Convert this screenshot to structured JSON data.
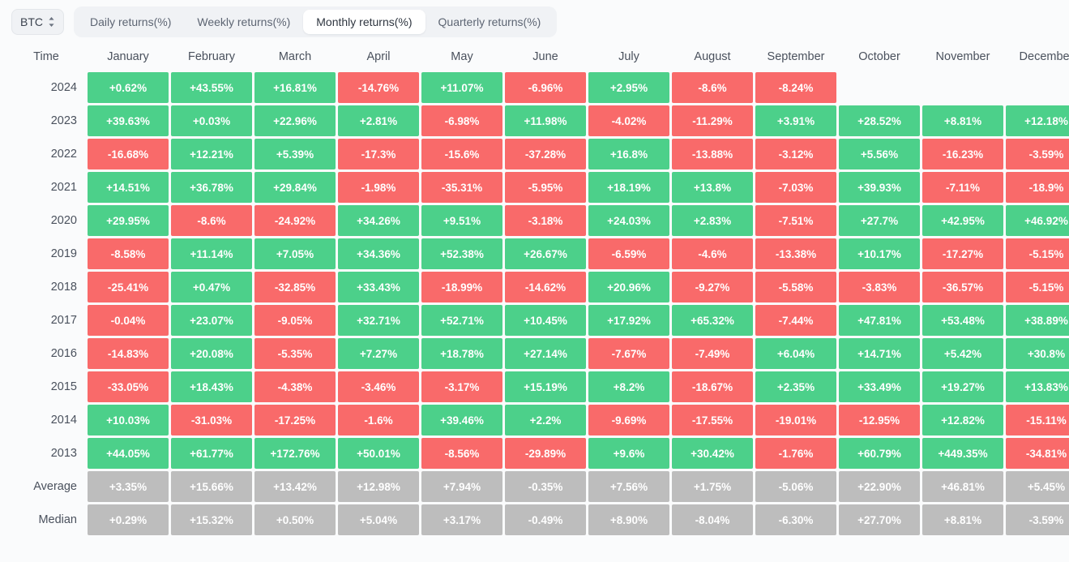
{
  "toolbar": {
    "asset": "BTC",
    "asset_chevron_icon": "chevron-up-down-icon",
    "tabs": [
      {
        "label": "Daily returns(%)",
        "active": false
      },
      {
        "label": "Weekly returns(%)",
        "active": false
      },
      {
        "label": "Monthly returns(%)",
        "active": true
      },
      {
        "label": "Quarterly returns(%)",
        "active": false
      }
    ]
  },
  "colors": {
    "positive": "#4cd08a",
    "negative": "#f96a6a",
    "neutral": "#bdbdbd",
    "page_bg": "#fafbfc",
    "tab_active_bg": "#ffffff",
    "tabbar_bg": "#f0f2f5"
  },
  "chart_data": {
    "type": "heatmap",
    "title": "Monthly returns(%)",
    "xlabel": "",
    "ylabel": "Time",
    "grid": true,
    "legend_position": "none",
    "columns": [
      "Time",
      "January",
      "February",
      "March",
      "April",
      "May",
      "June",
      "July",
      "August",
      "September",
      "October",
      "November",
      "December"
    ],
    "categories": [
      "January",
      "February",
      "March",
      "April",
      "May",
      "June",
      "July",
      "August",
      "September",
      "October",
      "November",
      "December"
    ],
    "rows": [
      {
        "label": "2024",
        "kind": "year",
        "values": [
          "+0.62%",
          "+43.55%",
          "+16.81%",
          "-14.76%",
          "+11.07%",
          "-6.96%",
          "+2.95%",
          "-8.6%",
          "-8.24%",
          "",
          "",
          ""
        ]
      },
      {
        "label": "2023",
        "kind": "year",
        "values": [
          "+39.63%",
          "+0.03%",
          "+22.96%",
          "+2.81%",
          "-6.98%",
          "+11.98%",
          "-4.02%",
          "-11.29%",
          "+3.91%",
          "+28.52%",
          "+8.81%",
          "+12.18%"
        ]
      },
      {
        "label": "2022",
        "kind": "year",
        "values": [
          "-16.68%",
          "+12.21%",
          "+5.39%",
          "-17.3%",
          "-15.6%",
          "-37.28%",
          "+16.8%",
          "-13.88%",
          "-3.12%",
          "+5.56%",
          "-16.23%",
          "-3.59%"
        ]
      },
      {
        "label": "2021",
        "kind": "year",
        "values": [
          "+14.51%",
          "+36.78%",
          "+29.84%",
          "-1.98%",
          "-35.31%",
          "-5.95%",
          "+18.19%",
          "+13.8%",
          "-7.03%",
          "+39.93%",
          "-7.11%",
          "-18.9%"
        ]
      },
      {
        "label": "2020",
        "kind": "year",
        "values": [
          "+29.95%",
          "-8.6%",
          "-24.92%",
          "+34.26%",
          "+9.51%",
          "-3.18%",
          "+24.03%",
          "+2.83%",
          "-7.51%",
          "+27.7%",
          "+42.95%",
          "+46.92%"
        ]
      },
      {
        "label": "2019",
        "kind": "year",
        "values": [
          "-8.58%",
          "+11.14%",
          "+7.05%",
          "+34.36%",
          "+52.38%",
          "+26.67%",
          "-6.59%",
          "-4.6%",
          "-13.38%",
          "+10.17%",
          "-17.27%",
          "-5.15%"
        ]
      },
      {
        "label": "2018",
        "kind": "year",
        "values": [
          "-25.41%",
          "+0.47%",
          "-32.85%",
          "+33.43%",
          "-18.99%",
          "-14.62%",
          "+20.96%",
          "-9.27%",
          "-5.58%",
          "-3.83%",
          "-36.57%",
          "-5.15%"
        ]
      },
      {
        "label": "2017",
        "kind": "year",
        "values": [
          "-0.04%",
          "+23.07%",
          "-9.05%",
          "+32.71%",
          "+52.71%",
          "+10.45%",
          "+17.92%",
          "+65.32%",
          "-7.44%",
          "+47.81%",
          "+53.48%",
          "+38.89%"
        ]
      },
      {
        "label": "2016",
        "kind": "year",
        "values": [
          "-14.83%",
          "+20.08%",
          "-5.35%",
          "+7.27%",
          "+18.78%",
          "+27.14%",
          "-7.67%",
          "-7.49%",
          "+6.04%",
          "+14.71%",
          "+5.42%",
          "+30.8%"
        ]
      },
      {
        "label": "2015",
        "kind": "year",
        "values": [
          "-33.05%",
          "+18.43%",
          "-4.38%",
          "-3.46%",
          "-3.17%",
          "+15.19%",
          "+8.2%",
          "-18.67%",
          "+2.35%",
          "+33.49%",
          "+19.27%",
          "+13.83%"
        ]
      },
      {
        "label": "2014",
        "kind": "year",
        "values": [
          "+10.03%",
          "-31.03%",
          "-17.25%",
          "-1.6%",
          "+39.46%",
          "+2.2%",
          "-9.69%",
          "-17.55%",
          "-19.01%",
          "-12.95%",
          "+12.82%",
          "-15.11%"
        ]
      },
      {
        "label": "2013",
        "kind": "year",
        "values": [
          "+44.05%",
          "+61.77%",
          "+172.76%",
          "+50.01%",
          "-8.56%",
          "-29.89%",
          "+9.6%",
          "+30.42%",
          "-1.76%",
          "+60.79%",
          "+449.35%",
          "-34.81%"
        ]
      },
      {
        "label": "Average",
        "kind": "summary",
        "values": [
          "+3.35%",
          "+15.66%",
          "+13.42%",
          "+12.98%",
          "+7.94%",
          "-0.35%",
          "+7.56%",
          "+1.75%",
          "-5.06%",
          "+22.90%",
          "+46.81%",
          "+5.45%"
        ]
      },
      {
        "label": "Median",
        "kind": "summary",
        "values": [
          "+0.29%",
          "+15.32%",
          "+0.50%",
          "+5.04%",
          "+3.17%",
          "-0.49%",
          "+8.90%",
          "-8.04%",
          "-6.30%",
          "+27.70%",
          "+8.81%",
          "-3.59%"
        ]
      }
    ]
  }
}
